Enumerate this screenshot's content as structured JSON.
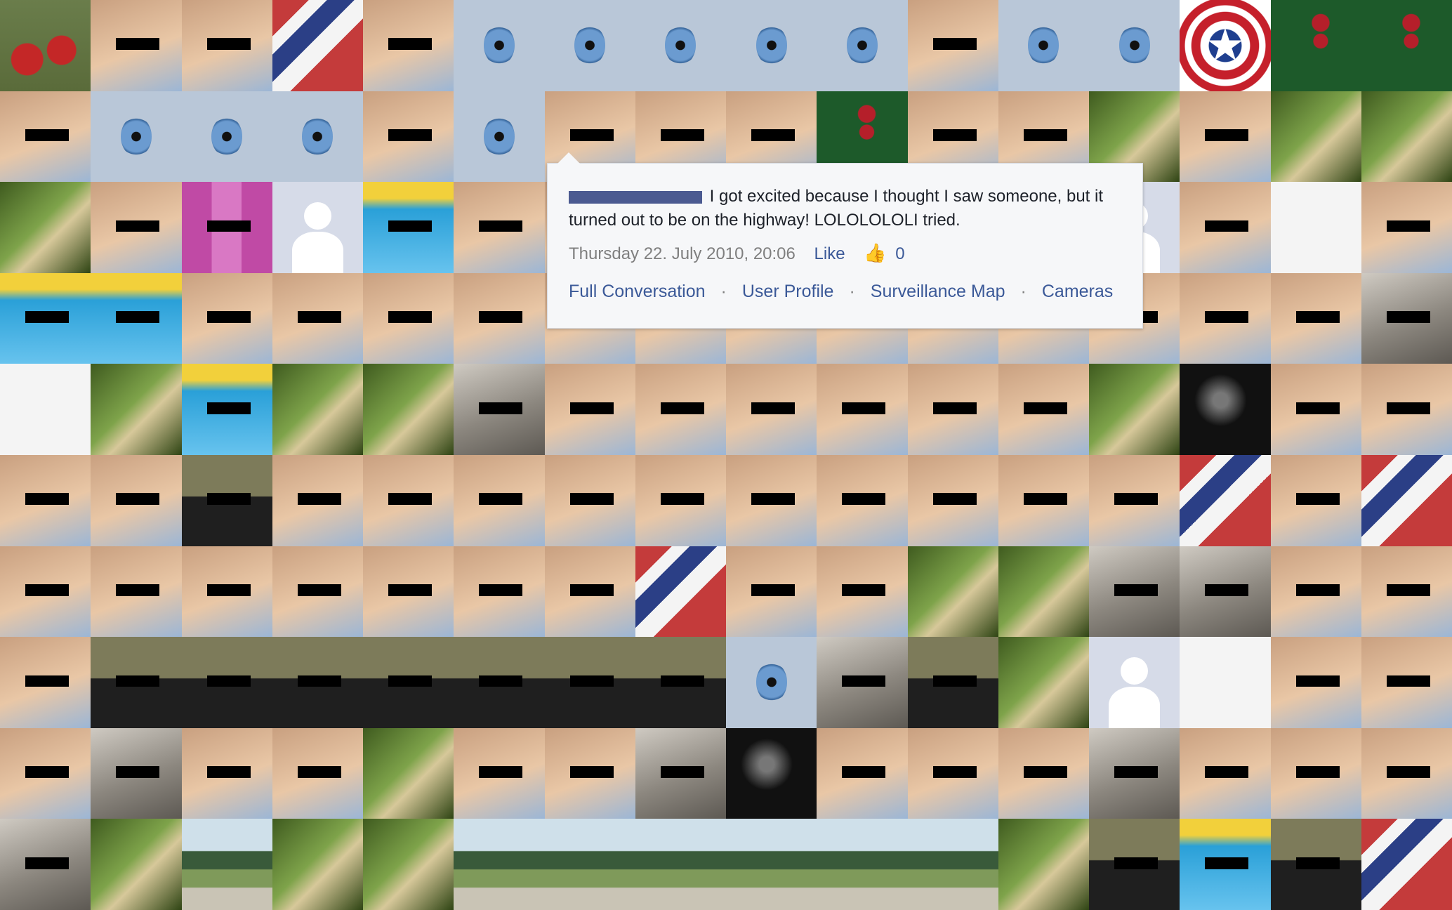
{
  "popup": {
    "message": "I got excited because I thought I saw someone, but it turned out to be on the highway! LOLOLOLOLI tried.",
    "timestamp": "Thursday 22. July 2010, 20:06",
    "like_label": "Like",
    "like_icon": "thumbs-up-icon",
    "like_count": "0",
    "links": [
      "Full Conversation",
      "User Profile",
      "Surveillance Map",
      "Cameras"
    ],
    "separator": "·"
  },
  "grid": {
    "columns": 16,
    "rows": 10,
    "palette": {
      "eye": "#b9c7d8",
      "face": "#c9a080",
      "lizard": "#7ea34a",
      "pool": "#2aa0d8",
      "blank": "#d6dbe8",
      "flag": "#c43b3b",
      "couple": "#3d3c32",
      "dark": "#222222",
      "road": "#8aa6b2",
      "skeleton": "#f4f4f4",
      "girl": "#8d8a85",
      "pink": "#c04aa5",
      "chips": "#1d5a2a",
      "shield": "#c5202b",
      "fruit": "#b32222"
    },
    "tiles": [
      "fruit",
      "face",
      "face",
      "flag",
      "face",
      "eye",
      "eye",
      "eye",
      "eye",
      "eye",
      "face",
      "eye",
      "eye",
      "shield",
      "chips",
      "chips",
      "face",
      "eye",
      "eye",
      "eye",
      "face",
      "eye",
      "face",
      "face",
      "face",
      "chips",
      "face",
      "face",
      "lizard",
      "face",
      "lizard",
      "lizard",
      "lizard",
      "face",
      "pink",
      "blank",
      "pool",
      "face",
      "face",
      "face",
      "face",
      "face",
      "face",
      "face",
      "blank",
      "face",
      "skeleton",
      "face",
      "pool",
      "pool",
      "face",
      "face",
      "face",
      "face",
      "face",
      "face",
      "face",
      "face",
      "face",
      "face",
      "face",
      "face",
      "face",
      "girl",
      "skeleton",
      "lizard",
      "pool",
      "lizard",
      "lizard",
      "girl",
      "face",
      "face",
      "face",
      "face",
      "face",
      "face",
      "lizard",
      "dark",
      "face",
      "face",
      "face",
      "face",
      "couple",
      "face",
      "face",
      "face",
      "face",
      "face",
      "face",
      "face",
      "face",
      "face",
      "face",
      "flag",
      "face",
      "flag",
      "face",
      "face",
      "face",
      "face",
      "face",
      "face",
      "face",
      "flag",
      "face",
      "face",
      "lizard",
      "lizard",
      "girl",
      "girl",
      "face",
      "face",
      "face",
      "couple",
      "couple",
      "couple",
      "couple",
      "couple",
      "couple",
      "couple",
      "eye",
      "girl",
      "couple",
      "lizard",
      "blank",
      "skeleton",
      "face",
      "face",
      "face",
      "girl",
      "face",
      "face",
      "lizard",
      "face",
      "face",
      "girl",
      "dark",
      "face",
      "face",
      "face",
      "girl",
      "face",
      "face",
      "face",
      "girl",
      "lizard",
      "road",
      "lizard",
      "lizard",
      "road",
      "road",
      "road",
      "road",
      "road",
      "road",
      "lizard",
      "couple",
      "pool",
      "couple",
      "flag"
    ]
  }
}
